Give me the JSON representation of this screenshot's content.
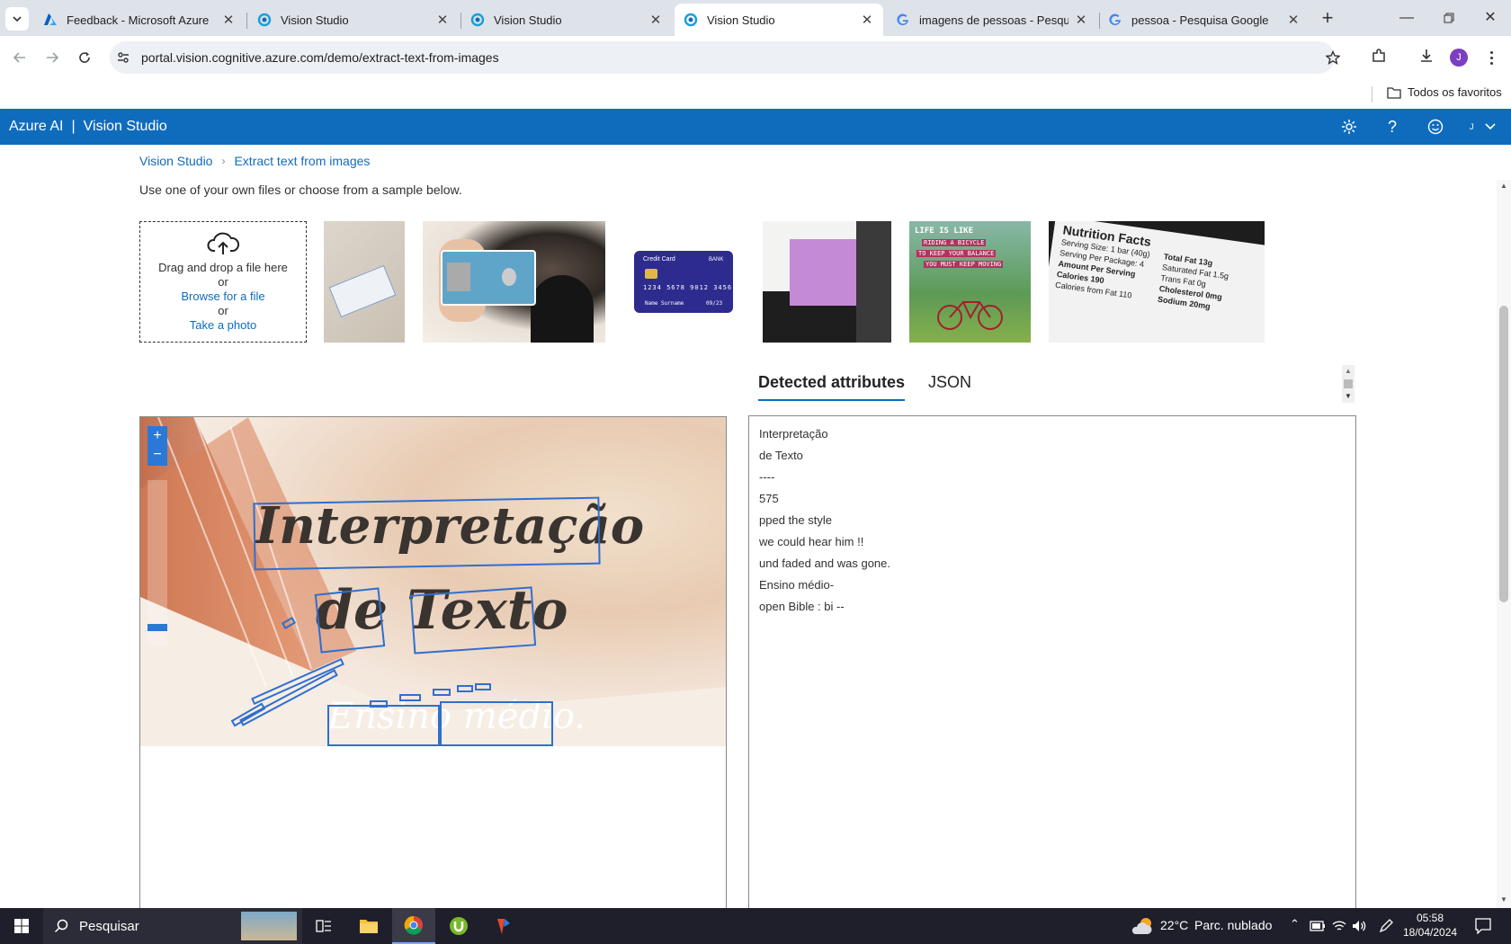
{
  "browser": {
    "tabs": [
      {
        "title": "Feedback - Microsoft Azure",
        "icon": "azure-icon",
        "active": false
      },
      {
        "title": "Vision Studio",
        "icon": "vision-studio-icon",
        "active": false
      },
      {
        "title": "Vision Studio",
        "icon": "vision-studio-icon",
        "active": false
      },
      {
        "title": "Vision Studio",
        "icon": "vision-studio-icon",
        "active": true
      },
      {
        "title": "imagens de pessoas - Pesquisa",
        "icon": "google-icon",
        "active": false
      },
      {
        "title": "pessoa - Pesquisa Google",
        "icon": "google-icon",
        "active": false
      }
    ],
    "url": "portal.vision.cognitive.azure.com/demo/extract-text-from-images",
    "bookmarks_folder": "Todos os favoritos",
    "profile_initial": "J"
  },
  "app": {
    "brand": "Azure AI",
    "separator": "|",
    "product": "Vision Studio",
    "user_initial": "J"
  },
  "breadcrumb": {
    "home": "Vision Studio",
    "current": "Extract text from images"
  },
  "intro": "Use one of your own files or choose from a sample below.",
  "upload": {
    "drag_text": "Drag and drop a file here",
    "or1": "or",
    "browse": "Browse for a file",
    "or2": "or",
    "take_photo": "Take a photo"
  },
  "samples": {
    "credit_card_brand": "Credit Card",
    "credit_card_bank": "BANK",
    "credit_card_number": "1234 5678 9012 3456",
    "credit_card_name": "Name Surname",
    "credit_card_exp": "09/23",
    "poster_lines": [
      "LIFE IS LIKE",
      "RIDING A BICYCLE",
      "TO KEEP YOUR BALANCE",
      "YOU MUST KEEP MOVING"
    ],
    "nutrition_title": "Nutrition Facts",
    "nutrition_lines": [
      "Serving Size: 1 bar (40g)",
      "Serving Per Package: 4",
      "Amount Per Serving",
      "Calories 190",
      "Calories from Fat 110",
      "Total Fat 13g",
      "Saturated Fat 1.5g",
      "Trans Fat 0g",
      "Cholesterol 0mg",
      "Sodium 20mg"
    ]
  },
  "result_tabs": {
    "detected": "Detected attributes",
    "json": "JSON"
  },
  "preview": {
    "title_line1": "Interpretação",
    "title_line2": "de Texto",
    "title_line3": "Ensino médio."
  },
  "detected_lines": [
    "Interpretação",
    "de Texto",
    "----",
    "575",
    "pped the style",
    "we could hear him !!",
    "und faded and was gone.",
    "Ensino médio-",
    "open Bible : bi --"
  ],
  "taskbar": {
    "search_placeholder": "Pesquisar",
    "weather_temp": "22°C",
    "weather_desc": "Parc. nublado",
    "time": "05:58",
    "date": "18/04/2024"
  },
  "colors": {
    "accent": "#0f6cbd",
    "tabstrip": "#dee3ea",
    "taskbar": "#1f1f2b"
  }
}
